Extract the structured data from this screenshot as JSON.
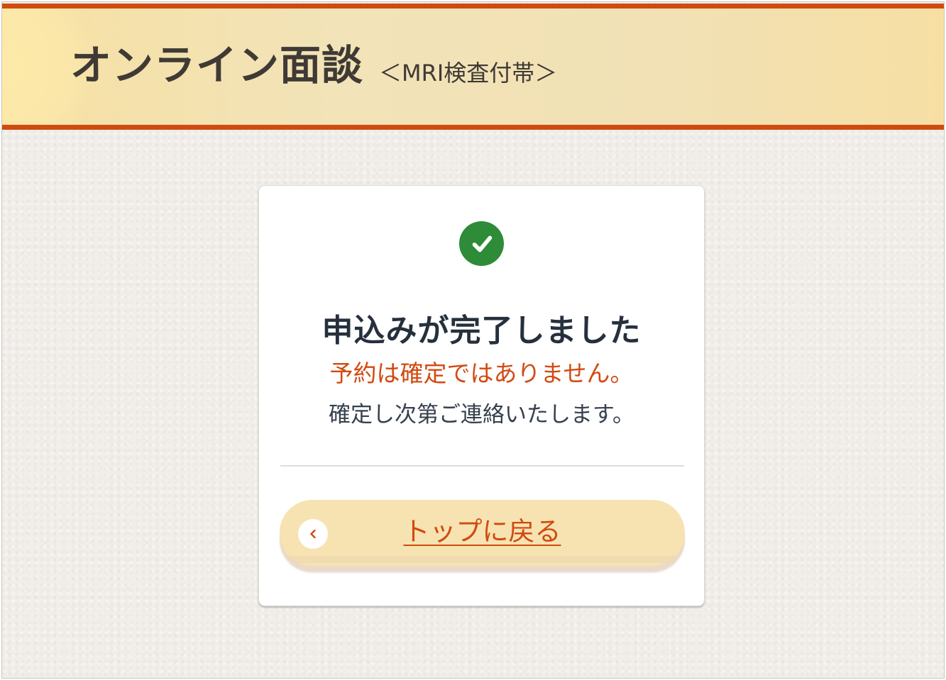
{
  "header": {
    "title": "オンライン面談",
    "subtitle": "＜MRI検査付帯＞"
  },
  "card": {
    "status_icon": "check-circle-icon",
    "title": "申込みが完了しました",
    "warning": "予約は確定ではありません。",
    "info": "確定し次第ご連絡いたします。",
    "back_button": {
      "icon": "chevron-left-icon",
      "label": "トップに戻る"
    }
  },
  "colors": {
    "accent": "#cf4b10",
    "success": "#2e8b37",
    "button_bg": "#f6e3b1",
    "title_text": "#26303d",
    "background": "#f1eeea"
  }
}
